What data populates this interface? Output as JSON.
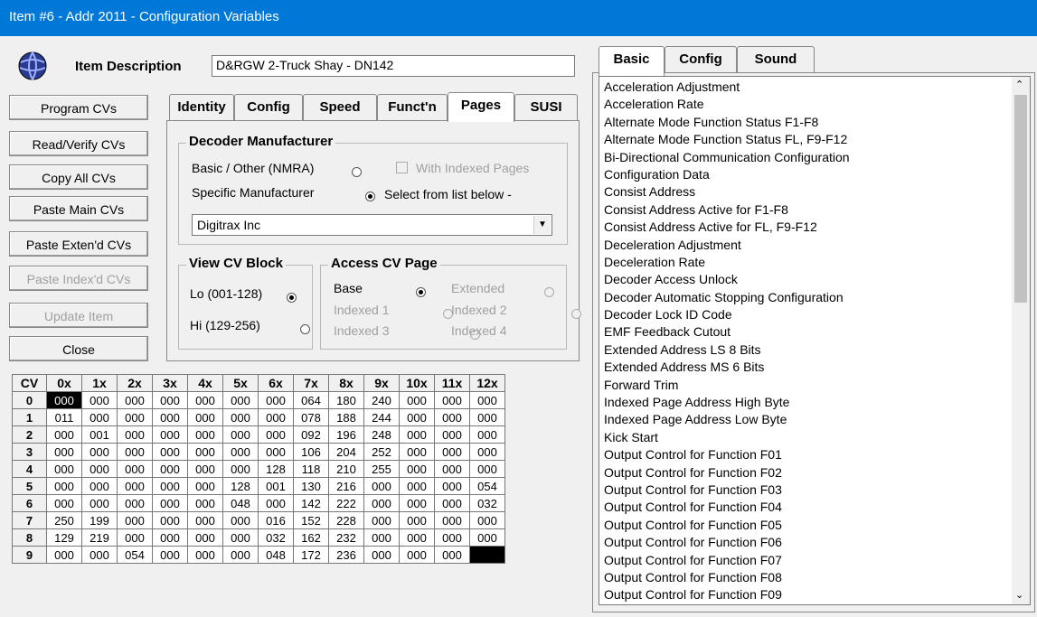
{
  "window": {
    "title": "Item #6 - Addr 2011 - Configuration Variables"
  },
  "item_description": {
    "label": "Item Description",
    "value": "D&RGW 2-Truck Shay - DN142"
  },
  "buttons": [
    {
      "label": "Program CVs",
      "enabled": true
    },
    {
      "label": "Read/Verify CVs",
      "enabled": true
    },
    {
      "label": "Copy All CVs",
      "enabled": true
    },
    {
      "label": "Paste Main CVs",
      "enabled": true
    },
    {
      "label": "Paste Exten'd CVs",
      "enabled": true
    },
    {
      "label": "Paste Index'd CVs",
      "enabled": false
    },
    {
      "label": "Update Item",
      "enabled": false
    },
    {
      "label": "Close",
      "enabled": true
    }
  ],
  "tabs": [
    "Identity",
    "Config",
    "Speed",
    "Funct'n",
    "Pages",
    "SUSI"
  ],
  "active_tab": "Pages",
  "decoder_manufacturer": {
    "title": "Decoder Manufacturer",
    "basic_label": "Basic / Other (NMRA)",
    "with_indexed_label": "With Indexed Pages",
    "specific_label": "Specific Manufacturer",
    "select_hint": "Select from list below  -",
    "selected_manufacturer": "Digitrax Inc"
  },
  "view_cv_block": {
    "title": "View CV Block",
    "lo": "Lo  (001-128)",
    "hi": "Hi  (129-256)"
  },
  "access_cv_page": {
    "title": "Access CV Page",
    "base": "Base",
    "extended": "Extended",
    "indexed1": "Indexed 1",
    "indexed2": "Indexed 2",
    "indexed3": "Indexed 3",
    "indexed4": "Indexed 4"
  },
  "cv_table": {
    "corner": "CV",
    "columns": [
      "0x",
      "1x",
      "2x",
      "3x",
      "4x",
      "5x",
      "6x",
      "7x",
      "8x",
      "9x",
      "10x",
      "11x",
      "12x"
    ],
    "rows": [
      {
        "label": "0",
        "values": [
          "000",
          "000",
          "000",
          "000",
          "000",
          "000",
          "000",
          "064",
          "180",
          "240",
          "000",
          "000",
          "000"
        ]
      },
      {
        "label": "1",
        "values": [
          "011",
          "000",
          "000",
          "000",
          "000",
          "000",
          "000",
          "078",
          "188",
          "244",
          "000",
          "000",
          "000"
        ]
      },
      {
        "label": "2",
        "values": [
          "000",
          "001",
          "000",
          "000",
          "000",
          "000",
          "000",
          "092",
          "196",
          "248",
          "000",
          "000",
          "000"
        ]
      },
      {
        "label": "3",
        "values": [
          "000",
          "000",
          "000",
          "000",
          "000",
          "000",
          "000",
          "106",
          "204",
          "252",
          "000",
          "000",
          "000"
        ]
      },
      {
        "label": "4",
        "values": [
          "000",
          "000",
          "000",
          "000",
          "000",
          "000",
          "128",
          "118",
          "210",
          "255",
          "000",
          "000",
          "000"
        ]
      },
      {
        "label": "5",
        "values": [
          "000",
          "000",
          "000",
          "000",
          "000",
          "128",
          "001",
          "130",
          "216",
          "000",
          "000",
          "000",
          "054"
        ]
      },
      {
        "label": "6",
        "values": [
          "000",
          "000",
          "000",
          "000",
          "000",
          "048",
          "000",
          "142",
          "222",
          "000",
          "000",
          "000",
          "032"
        ]
      },
      {
        "label": "7",
        "values": [
          "250",
          "199",
          "000",
          "000",
          "000",
          "000",
          "016",
          "152",
          "228",
          "000",
          "000",
          "000",
          "000"
        ]
      },
      {
        "label": "8",
        "values": [
          "129",
          "219",
          "000",
          "000",
          "000",
          "000",
          "032",
          "162",
          "232",
          "000",
          "000",
          "000",
          "000"
        ]
      },
      {
        "label": "9",
        "values": [
          "000",
          "000",
          "054",
          "000",
          "000",
          "000",
          "048",
          "172",
          "236",
          "000",
          "000",
          "000",
          ""
        ]
      }
    ]
  },
  "right_tabs": [
    "Basic",
    "Config",
    "Sound"
  ],
  "right_active_tab": "Basic",
  "cv_names": [
    "Acceleration Adjustment",
    "Acceleration Rate",
    "Alternate Mode Function Status F1-F8",
    "Alternate Mode Function Status FL, F9-F12",
    "Bi-Directional Communication Configuration",
    "Configuration Data",
    "Consist Address",
    "Consist Address Active for F1-F8",
    "Consist Address Active for FL, F9-F12",
    "Deceleration Adjustment",
    "Deceleration Rate",
    "Decoder Access Unlock",
    "Decoder Automatic Stopping Configuration",
    "Decoder Lock ID Code",
    "EMF Feedback Cutout",
    "Extended Address LS 8 Bits",
    "Extended Address MS 6 Bits",
    "Forward Trim",
    "Indexed Page Address High Byte",
    "Indexed Page Address Low Byte",
    "Kick Start",
    "Output Control for Function F01",
    "Output Control for Function F02",
    "Output Control for Function F03",
    "Output Control for Function F04",
    "Output Control for Function F05",
    "Output Control for Function F06",
    "Output Control for Function F07",
    "Output Control for Function F08",
    "Output Control for Function F09"
  ]
}
